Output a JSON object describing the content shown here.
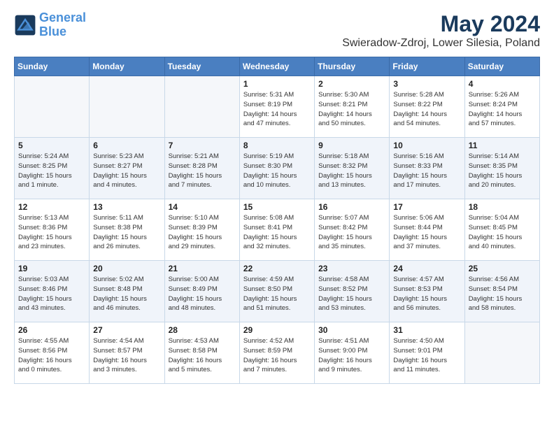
{
  "logo": {
    "line1": "General",
    "line2": "Blue"
  },
  "title": "May 2024",
  "subtitle": "Swieradow-Zdroj, Lower Silesia, Poland",
  "days_of_week": [
    "Sunday",
    "Monday",
    "Tuesday",
    "Wednesday",
    "Thursday",
    "Friday",
    "Saturday"
  ],
  "weeks": [
    [
      {
        "day": "",
        "info": ""
      },
      {
        "day": "",
        "info": ""
      },
      {
        "day": "",
        "info": ""
      },
      {
        "day": "1",
        "info": "Sunrise: 5:31 AM\nSunset: 8:19 PM\nDaylight: 14 hours\nand 47 minutes."
      },
      {
        "day": "2",
        "info": "Sunrise: 5:30 AM\nSunset: 8:21 PM\nDaylight: 14 hours\nand 50 minutes."
      },
      {
        "day": "3",
        "info": "Sunrise: 5:28 AM\nSunset: 8:22 PM\nDaylight: 14 hours\nand 54 minutes."
      },
      {
        "day": "4",
        "info": "Sunrise: 5:26 AM\nSunset: 8:24 PM\nDaylight: 14 hours\nand 57 minutes."
      }
    ],
    [
      {
        "day": "5",
        "info": "Sunrise: 5:24 AM\nSunset: 8:25 PM\nDaylight: 15 hours\nand 1 minute."
      },
      {
        "day": "6",
        "info": "Sunrise: 5:23 AM\nSunset: 8:27 PM\nDaylight: 15 hours\nand 4 minutes."
      },
      {
        "day": "7",
        "info": "Sunrise: 5:21 AM\nSunset: 8:28 PM\nDaylight: 15 hours\nand 7 minutes."
      },
      {
        "day": "8",
        "info": "Sunrise: 5:19 AM\nSunset: 8:30 PM\nDaylight: 15 hours\nand 10 minutes."
      },
      {
        "day": "9",
        "info": "Sunrise: 5:18 AM\nSunset: 8:32 PM\nDaylight: 15 hours\nand 13 minutes."
      },
      {
        "day": "10",
        "info": "Sunrise: 5:16 AM\nSunset: 8:33 PM\nDaylight: 15 hours\nand 17 minutes."
      },
      {
        "day": "11",
        "info": "Sunrise: 5:14 AM\nSunset: 8:35 PM\nDaylight: 15 hours\nand 20 minutes."
      }
    ],
    [
      {
        "day": "12",
        "info": "Sunrise: 5:13 AM\nSunset: 8:36 PM\nDaylight: 15 hours\nand 23 minutes."
      },
      {
        "day": "13",
        "info": "Sunrise: 5:11 AM\nSunset: 8:38 PM\nDaylight: 15 hours\nand 26 minutes."
      },
      {
        "day": "14",
        "info": "Sunrise: 5:10 AM\nSunset: 8:39 PM\nDaylight: 15 hours\nand 29 minutes."
      },
      {
        "day": "15",
        "info": "Sunrise: 5:08 AM\nSunset: 8:41 PM\nDaylight: 15 hours\nand 32 minutes."
      },
      {
        "day": "16",
        "info": "Sunrise: 5:07 AM\nSunset: 8:42 PM\nDaylight: 15 hours\nand 35 minutes."
      },
      {
        "day": "17",
        "info": "Sunrise: 5:06 AM\nSunset: 8:44 PM\nDaylight: 15 hours\nand 37 minutes."
      },
      {
        "day": "18",
        "info": "Sunrise: 5:04 AM\nSunset: 8:45 PM\nDaylight: 15 hours\nand 40 minutes."
      }
    ],
    [
      {
        "day": "19",
        "info": "Sunrise: 5:03 AM\nSunset: 8:46 PM\nDaylight: 15 hours\nand 43 minutes."
      },
      {
        "day": "20",
        "info": "Sunrise: 5:02 AM\nSunset: 8:48 PM\nDaylight: 15 hours\nand 46 minutes."
      },
      {
        "day": "21",
        "info": "Sunrise: 5:00 AM\nSunset: 8:49 PM\nDaylight: 15 hours\nand 48 minutes."
      },
      {
        "day": "22",
        "info": "Sunrise: 4:59 AM\nSunset: 8:50 PM\nDaylight: 15 hours\nand 51 minutes."
      },
      {
        "day": "23",
        "info": "Sunrise: 4:58 AM\nSunset: 8:52 PM\nDaylight: 15 hours\nand 53 minutes."
      },
      {
        "day": "24",
        "info": "Sunrise: 4:57 AM\nSunset: 8:53 PM\nDaylight: 15 hours\nand 56 minutes."
      },
      {
        "day": "25",
        "info": "Sunrise: 4:56 AM\nSunset: 8:54 PM\nDaylight: 15 hours\nand 58 minutes."
      }
    ],
    [
      {
        "day": "26",
        "info": "Sunrise: 4:55 AM\nSunset: 8:56 PM\nDaylight: 16 hours\nand 0 minutes."
      },
      {
        "day": "27",
        "info": "Sunrise: 4:54 AM\nSunset: 8:57 PM\nDaylight: 16 hours\nand 3 minutes."
      },
      {
        "day": "28",
        "info": "Sunrise: 4:53 AM\nSunset: 8:58 PM\nDaylight: 16 hours\nand 5 minutes."
      },
      {
        "day": "29",
        "info": "Sunrise: 4:52 AM\nSunset: 8:59 PM\nDaylight: 16 hours\nand 7 minutes."
      },
      {
        "day": "30",
        "info": "Sunrise: 4:51 AM\nSunset: 9:00 PM\nDaylight: 16 hours\nand 9 minutes."
      },
      {
        "day": "31",
        "info": "Sunrise: 4:50 AM\nSunset: 9:01 PM\nDaylight: 16 hours\nand 11 minutes."
      },
      {
        "day": "",
        "info": ""
      }
    ]
  ]
}
